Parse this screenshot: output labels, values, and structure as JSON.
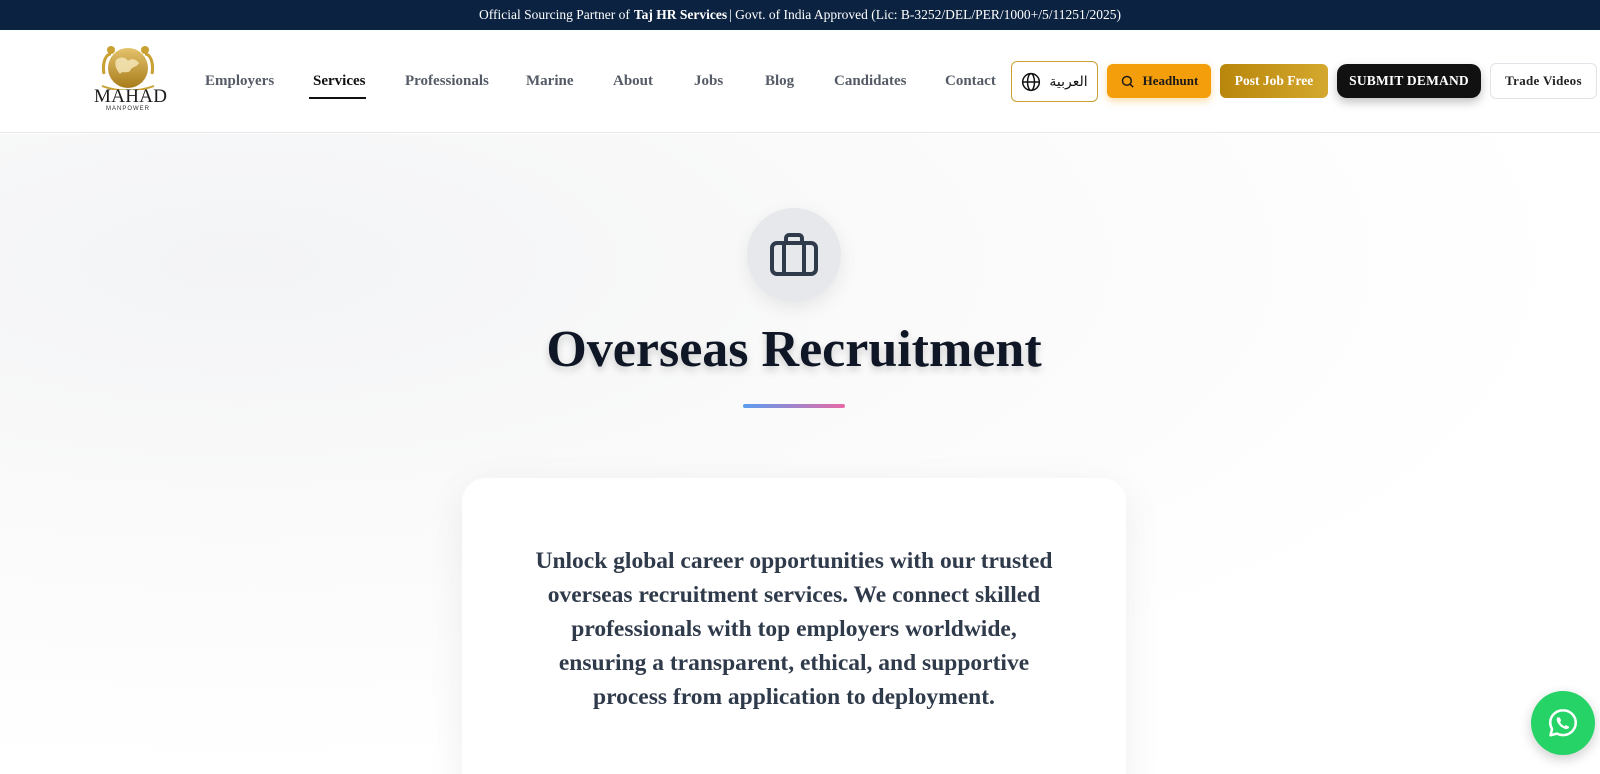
{
  "topbar": {
    "prefix": "Official Sourcing Partner of ",
    "partner": "Taj HR Services",
    "suffix": " | Govt. of India Approved (Lic: B-3252/DEL/PER/1000+/5/11251/2025)"
  },
  "logo": {
    "name": "MAHAD",
    "tagline": "MANPOWER"
  },
  "nav": {
    "items": [
      {
        "label": "Employers"
      },
      {
        "label": "Services"
      },
      {
        "label": "Professionals"
      },
      {
        "label": "Marine"
      },
      {
        "label": "About"
      },
      {
        "label": "Jobs"
      },
      {
        "label": "Blog"
      },
      {
        "label": "Candidates"
      },
      {
        "label": "Contact"
      }
    ],
    "active": "Services"
  },
  "actions": {
    "language": "العربية",
    "headhunt": "Headhunt",
    "post_job": "Post Job Free",
    "submit_demand": "SUBMIT DEMAND",
    "trade_videos": "Trade Videos"
  },
  "hero": {
    "icon": "briefcase-icon",
    "title": "Overseas Recruitment",
    "description": "Unlock global career opportunities with our trusted overseas recruitment services. We connect skilled professionals with top employers worldwide, ensuring a transparent, ethical, and supportive process from application to deployment."
  },
  "floating": {
    "icon": "whatsapp-icon"
  },
  "colors": {
    "topbar_bg": "#0b2341",
    "gold": "#c9a032",
    "headhunt": "#f59e0b",
    "submit": "#111111",
    "whatsapp": "#25d366",
    "divider_start": "#5b9cf0",
    "divider_end": "#e86aa5"
  }
}
